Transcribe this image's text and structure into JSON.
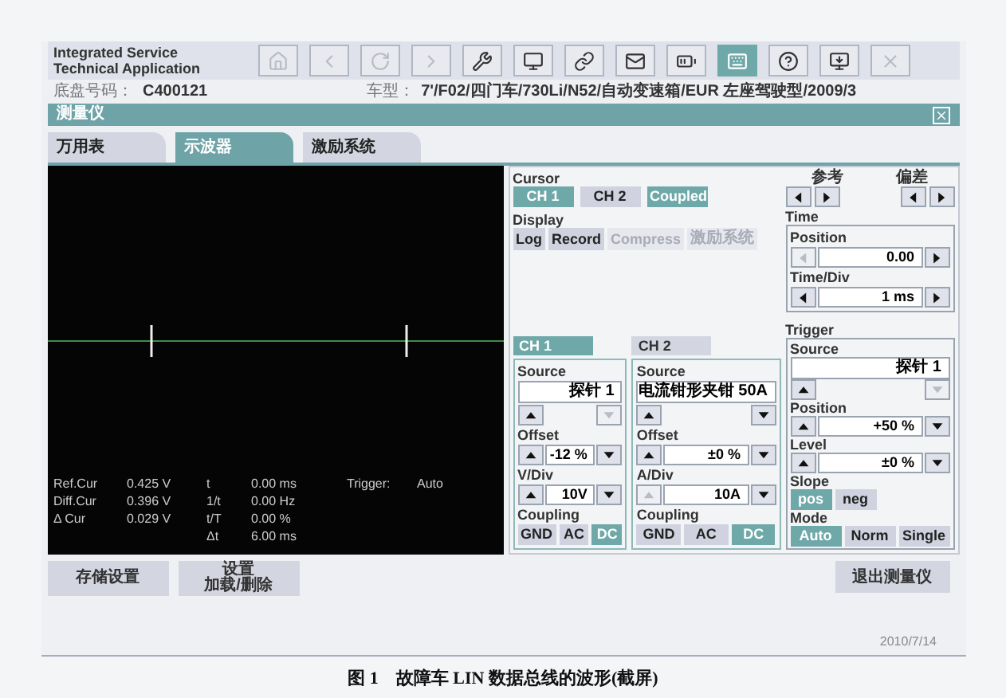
{
  "header": {
    "title_lines": [
      "Integrated Service",
      "Technical Application"
    ],
    "toolbar": [
      {
        "disabled": true,
        "selected": false
      },
      {
        "disabled": true,
        "selected": false
      },
      {
        "disabled": true,
        "selected": false
      },
      {
        "disabled": true,
        "selected": false
      },
      {
        "disabled": false,
        "selected": false
      },
      {
        "disabled": false,
        "selected": false
      },
      {
        "disabled": false,
        "selected": false
      },
      {
        "disabled": false,
        "selected": false
      },
      {
        "disabled": false,
        "selected": false
      },
      {
        "disabled": false,
        "selected": true
      },
      {
        "disabled": false,
        "selected": false
      },
      {
        "disabled": false,
        "selected": false
      },
      {
        "disabled": true,
        "selected": false
      }
    ]
  },
  "vehicle": {
    "chassis_label": "底盘号码：",
    "chassis_value": "C400121",
    "model_label": "车型：",
    "model_value": "7'/F02/四门车/730Li/N52/自动变速箱/EUR 左座驾驶型/2009/3"
  },
  "panel_title": "测量仪",
  "tabs": [
    {
      "label": "万用表",
      "selected": false
    },
    {
      "label": "示波器",
      "selected": true
    },
    {
      "label": "激励系统",
      "selected": false
    }
  ],
  "scope": {
    "readouts": [
      {
        "name": "Ref.Cur",
        "value": "0.425 V",
        "param": "t",
        "param_value": "0.00 ms"
      },
      {
        "name": "Diff.Cur",
        "value": "0.396 V",
        "param": "1/t",
        "param_value": "0.00 Hz"
      },
      {
        "name": "Δ Cur",
        "value": "0.029 V",
        "param": "t/T",
        "param_value": "0.00 %"
      },
      {
        "param": "Δt",
        "param_value": "6.00 ms"
      }
    ],
    "trigger_label": "Trigger:",
    "trigger_value": "Auto"
  },
  "cursor": {
    "label": "Cursor",
    "buttons": [
      {
        "label": "CH 1",
        "selected": true
      },
      {
        "label": "CH 2",
        "selected": false
      },
      {
        "label": "Coupled",
        "selected": true
      }
    ]
  },
  "display": {
    "label": "Display",
    "buttons": [
      {
        "label": "Log",
        "disabled": false
      },
      {
        "label": "Record",
        "disabled": false
      },
      {
        "label": "Compress",
        "disabled": true
      },
      {
        "label": "激励系统",
        "disabled": true
      }
    ]
  },
  "reference_label": "参考",
  "deviation_label": "偏差",
  "time": {
    "label": "Time",
    "position": {
      "label": "Position",
      "value": "0.00",
      "left_disabled": true
    },
    "time_div": {
      "label": "Time/Div",
      "value": "1 ms",
      "left_disabled": false
    }
  },
  "channels": [
    {
      "tab": "CH 1",
      "selected": true,
      "source_label": "Source",
      "source_value": "探针 1",
      "down_disabled": true,
      "offset_label": "Offset",
      "offset_value": "-12 %",
      "div_label": "V/Div",
      "div_value": "10V",
      "div_up_disabled": false,
      "coupling_label": "Coupling",
      "coupling": [
        {
          "label": "GND",
          "selected": false
        },
        {
          "label": "AC",
          "selected": false
        },
        {
          "label": "DC",
          "selected": true
        }
      ]
    },
    {
      "tab": "CH 2",
      "selected": false,
      "source_label": "Source",
      "source_value": "电流钳形夹钳 50A",
      "down_disabled": false,
      "offset_label": "Offset",
      "offset_value": "±0 %",
      "div_label": "A/Div",
      "div_value": "10A",
      "div_up_disabled": true,
      "coupling_label": "Coupling",
      "coupling": [
        {
          "label": "GND",
          "selected": false
        },
        {
          "label": "AC",
          "selected": false
        },
        {
          "label": "DC",
          "selected": true
        }
      ]
    }
  ],
  "trigger": {
    "label": "Trigger",
    "source_label": "Source",
    "source_value": "探针 1",
    "down_disabled": true,
    "position_label": "Position",
    "position_value": "+50 %",
    "level_label": "Level",
    "level_value": "±0 %",
    "slope_label": "Slope",
    "slope": [
      {
        "label": "pos",
        "selected": true
      },
      {
        "label": "neg",
        "selected": false
      }
    ],
    "mode_label": "Mode",
    "mode": [
      {
        "label": "Auto",
        "selected": true
      },
      {
        "label": "Norm",
        "selected": false
      },
      {
        "label": "Single",
        "selected": false
      }
    ]
  },
  "bottom_buttons": [
    {
      "lines": [
        "存储设置"
      ]
    },
    {
      "lines": [
        "设置",
        "加载/删除"
      ]
    }
  ],
  "exit_button": "退出测量仪",
  "date": "2010/7/14",
  "caption": "图 1　故障车 LIN 数据总线的波形(截屏)"
}
